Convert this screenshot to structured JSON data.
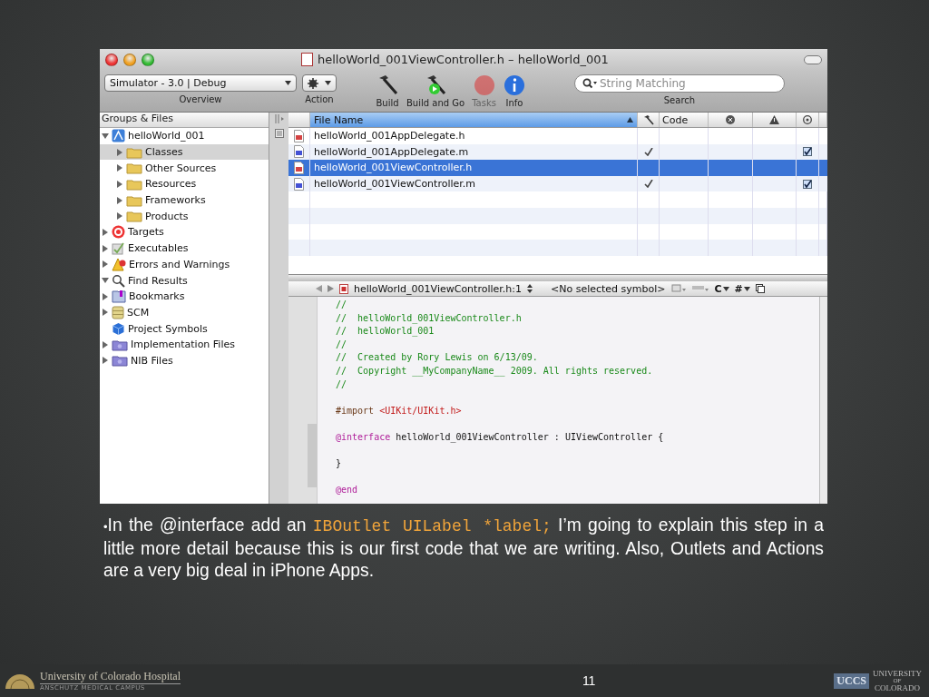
{
  "window": {
    "title": "helloWorld_001ViewController.h – helloWorld_001"
  },
  "toolbar": {
    "scheme": {
      "value": "Simulator - 3.0 | Debug",
      "label": "Overview"
    },
    "action": {
      "label": "Action"
    },
    "buttons": [
      {
        "kind": "build",
        "label": "Build",
        "disabled": false
      },
      {
        "kind": "build-go",
        "label": "Build and Go",
        "disabled": false
      },
      {
        "kind": "tasks",
        "label": "Tasks",
        "disabled": true
      },
      {
        "kind": "info",
        "label": "Info",
        "disabled": false
      }
    ],
    "search": {
      "placeholder": "String Matching",
      "label": "Search"
    }
  },
  "sidebar": {
    "header": "Groups & Files",
    "items": [
      {
        "kind": "project",
        "label": "helloWorld_001",
        "expanded": true,
        "selected": false,
        "children": [
          {
            "kind": "folder",
            "label": "Classes",
            "expanded": false,
            "selected": true
          },
          {
            "kind": "folder",
            "label": "Other Sources",
            "expanded": false,
            "selected": false
          },
          {
            "kind": "folder",
            "label": "Resources",
            "expanded": false,
            "selected": false
          },
          {
            "kind": "folder",
            "label": "Frameworks",
            "expanded": false,
            "selected": false
          },
          {
            "kind": "folder",
            "label": "Products",
            "expanded": false,
            "selected": false
          }
        ]
      },
      {
        "kind": "target",
        "label": "Targets",
        "expanded": false,
        "selected": false
      },
      {
        "kind": "executable",
        "label": "Executables",
        "expanded": false,
        "selected": false
      },
      {
        "kind": "warning",
        "label": "Errors and Warnings",
        "expanded": false,
        "selected": false
      },
      {
        "kind": "find",
        "label": "Find Results",
        "expanded": true,
        "selected": false
      },
      {
        "kind": "bookmark",
        "label": "Bookmarks",
        "expanded": false,
        "selected": false
      },
      {
        "kind": "scm",
        "label": "SCM",
        "expanded": false,
        "selected": false
      },
      {
        "kind": "symbols",
        "label": "Project Symbols",
        "selected": false
      },
      {
        "kind": "smartgroup",
        "label": "Implementation Files",
        "expanded": false,
        "selected": false
      },
      {
        "kind": "smartgroup",
        "label": "NIB Files",
        "expanded": false,
        "selected": false
      }
    ]
  },
  "file_table": {
    "columns": [
      {
        "kind": "name",
        "label": "File Name"
      },
      {
        "kind": "build"
      },
      {
        "kind": "text",
        "label": "Code"
      },
      {
        "kind": "errors"
      },
      {
        "kind": "warnings"
      },
      {
        "kind": "target"
      }
    ],
    "rows": [
      {
        "kind": "h",
        "name": "helloWorld_001AppDelegate.h",
        "built": false,
        "in_target": false,
        "selected": false
      },
      {
        "kind": "m",
        "name": "helloWorld_001AppDelegate.m",
        "built": true,
        "in_target": true,
        "selected": false
      },
      {
        "kind": "h",
        "name": "helloWorld_001ViewController.h",
        "built": false,
        "in_target": false,
        "selected": true
      },
      {
        "kind": "m",
        "name": "helloWorld_001ViewController.m",
        "built": true,
        "in_target": true,
        "selected": false
      }
    ]
  },
  "editor": {
    "file": "helloWorld_001ViewController.h:1",
    "symbol": "<No selected symbol>",
    "language": "C",
    "counterpart": "#",
    "lines": [
      {
        "kind": "comment",
        "text": "//"
      },
      {
        "kind": "comment",
        "text": "//  helloWorld_001ViewController.h"
      },
      {
        "kind": "comment",
        "text": "//  helloWorld_001"
      },
      {
        "kind": "comment",
        "text": "//"
      },
      {
        "kind": "comment",
        "text": "//  Created by Rory Lewis on 6/13/09."
      },
      {
        "kind": "comment",
        "text": "//  Copyright __MyCompanyName__ 2009. All rights reserved."
      },
      {
        "kind": "comment",
        "text": "//"
      },
      {
        "kind": "blank"
      },
      {
        "kind": "code",
        "parts": [
          {
            "kind": "directive",
            "text": "#import "
          },
          {
            "kind": "string",
            "text": "<UIKit/UIKit.h>"
          }
        ]
      },
      {
        "kind": "blank"
      },
      {
        "kind": "code",
        "parts": [
          {
            "kind": "keyword",
            "text": "@interface"
          },
          {
            "kind": "plain",
            "text": " helloWorld_001ViewController : UIViewController {"
          }
        ]
      },
      {
        "kind": "blank"
      },
      {
        "kind": "code",
        "parts": [
          {
            "kind": "plain",
            "text": "}"
          }
        ]
      },
      {
        "kind": "blank"
      },
      {
        "kind": "code",
        "parts": [
          {
            "kind": "keyword",
            "text": "@end"
          }
        ]
      }
    ]
  },
  "caption": {
    "bullet": "•",
    "parts": [
      {
        "kind": "plain",
        "text": "In the @interface add an "
      },
      {
        "kind": "code",
        "text": "IBOutlet UILabel *label;"
      },
      {
        "kind": "plain",
        "text": " I’m going to explain this step in a little more detail because this is our first code that we are writing. Also, Outlets and Actions are a very big deal in iPhone Apps."
      }
    ]
  },
  "footer": {
    "left_logo": {
      "name": "University of Colorado Hospital",
      "campus": "ANSCHUTZ MEDICAL CAMPUS"
    },
    "page_number": "11",
    "right_logo": {
      "mark": "UCCS",
      "line_1": "UNIVERSITY",
      "line_2": "OF",
      "line_3": "COLORADO"
    }
  }
}
